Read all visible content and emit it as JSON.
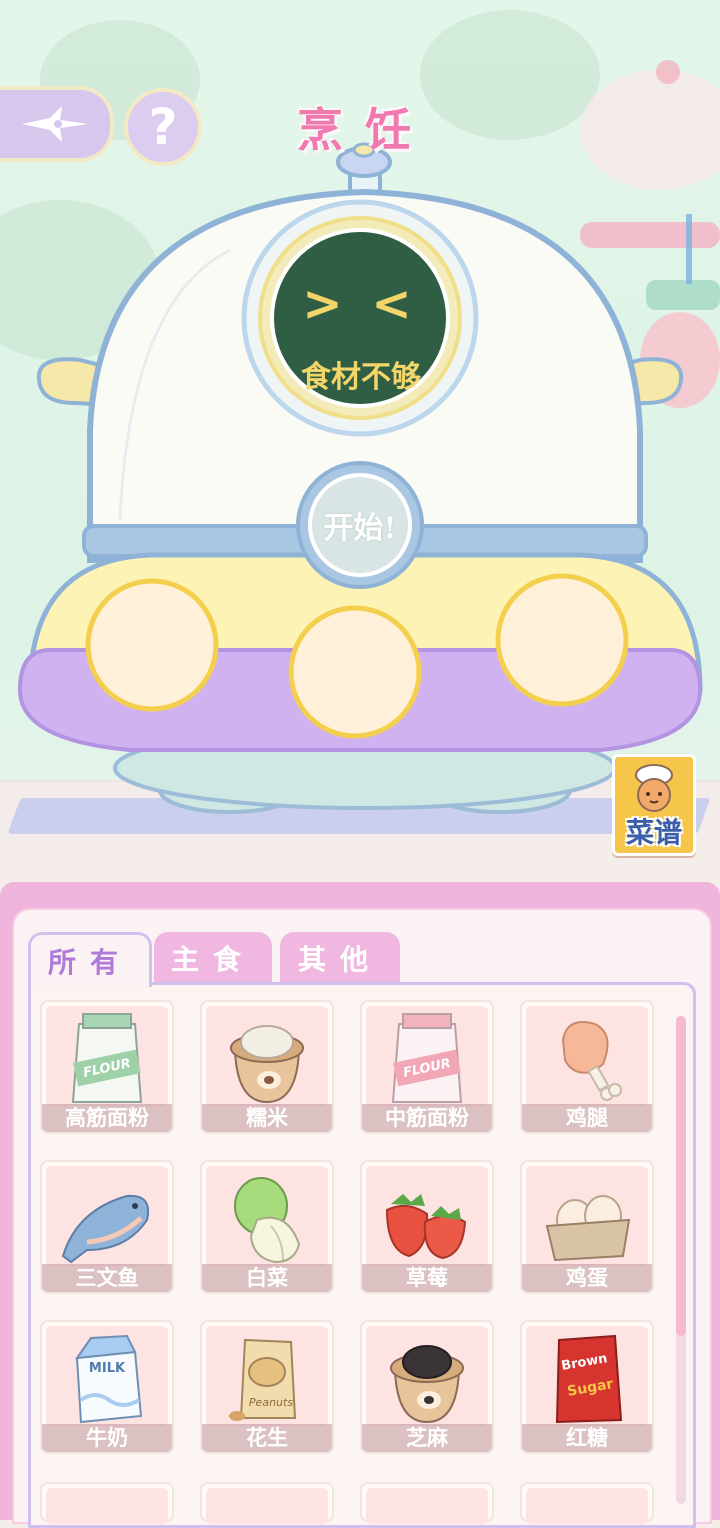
{
  "header": {
    "title": "烹饪",
    "help_label": "?"
  },
  "cooker": {
    "screen_text": "食材不够",
    "screen_face": "> <",
    "start_label": "开始!"
  },
  "recipe_book": {
    "label": "菜谱"
  },
  "tabs": [
    {
      "label": "所有",
      "active": true
    },
    {
      "label": "主食",
      "active": false
    },
    {
      "label": "其他",
      "active": false
    }
  ],
  "ingredients": [
    {
      "name": "高筋面粉",
      "icon": "flour-bag-icon"
    },
    {
      "name": "糯米",
      "icon": "rice-sack-icon"
    },
    {
      "name": "中筋面粉",
      "icon": "flour-bag-pink-icon"
    },
    {
      "name": "鸡腿",
      "icon": "chicken-leg-icon"
    },
    {
      "name": "三文鱼",
      "icon": "salmon-icon"
    },
    {
      "name": "白菜",
      "icon": "cabbage-icon"
    },
    {
      "name": "草莓",
      "icon": "strawberry-icon"
    },
    {
      "name": "鸡蛋",
      "icon": "eggs-icon"
    },
    {
      "name": "牛奶",
      "icon": "milk-carton-icon"
    },
    {
      "name": "花生",
      "icon": "peanut-bag-icon"
    },
    {
      "name": "芝麻",
      "icon": "sesame-sack-icon"
    },
    {
      "name": "红糖",
      "icon": "brown-sugar-bag-icon"
    }
  ],
  "packaging_text": {
    "flour": "FLOUR",
    "milk": "MILK",
    "peanuts": "Peanuts",
    "sugar_top": "Brown",
    "sugar_bottom": "Sugar"
  },
  "colors": {
    "title": "#f07ab0",
    "screen": "#2f5e45",
    "screen_text": "#f3d56a",
    "panel": "#efb5dd",
    "tab_active_text": "#b07ad8"
  }
}
